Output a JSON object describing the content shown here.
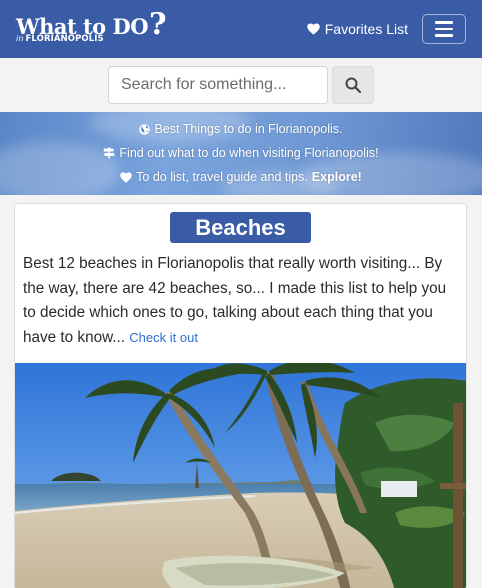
{
  "navbar": {
    "logo_main": "What to DO",
    "logo_q": "?",
    "logo_in": "in",
    "logo_city": "FLORIANOPOLIS",
    "favorites_label": "Favorites List",
    "icons": {
      "favorites": "heart-icon",
      "menu": "hamburger-menu-icon"
    }
  },
  "search": {
    "placeholder": "Search for something...",
    "icon": "search-icon"
  },
  "banner": {
    "line1": "Best Things to do in Florianopolis.",
    "line2": "Find out what to do when visiting Florianopolis!",
    "line3_text": "To do list, travel guide and tips.",
    "line3_cta": "Explore!",
    "icons": [
      "globe-icon",
      "signpost-icon",
      "heart-icon"
    ]
  },
  "card": {
    "title": "Beaches",
    "description": "Best 12 beaches in Florianopolis that really worth visiting... By the way, there are 42 beaches, so... I made this list to help you to decide which ones to go, talking about each thing that you have to know...",
    "link": "Check it out"
  },
  "colors": {
    "brand": "#3a5ba5",
    "link": "#2f6fd6",
    "page_bg": "#f3f3f3"
  }
}
